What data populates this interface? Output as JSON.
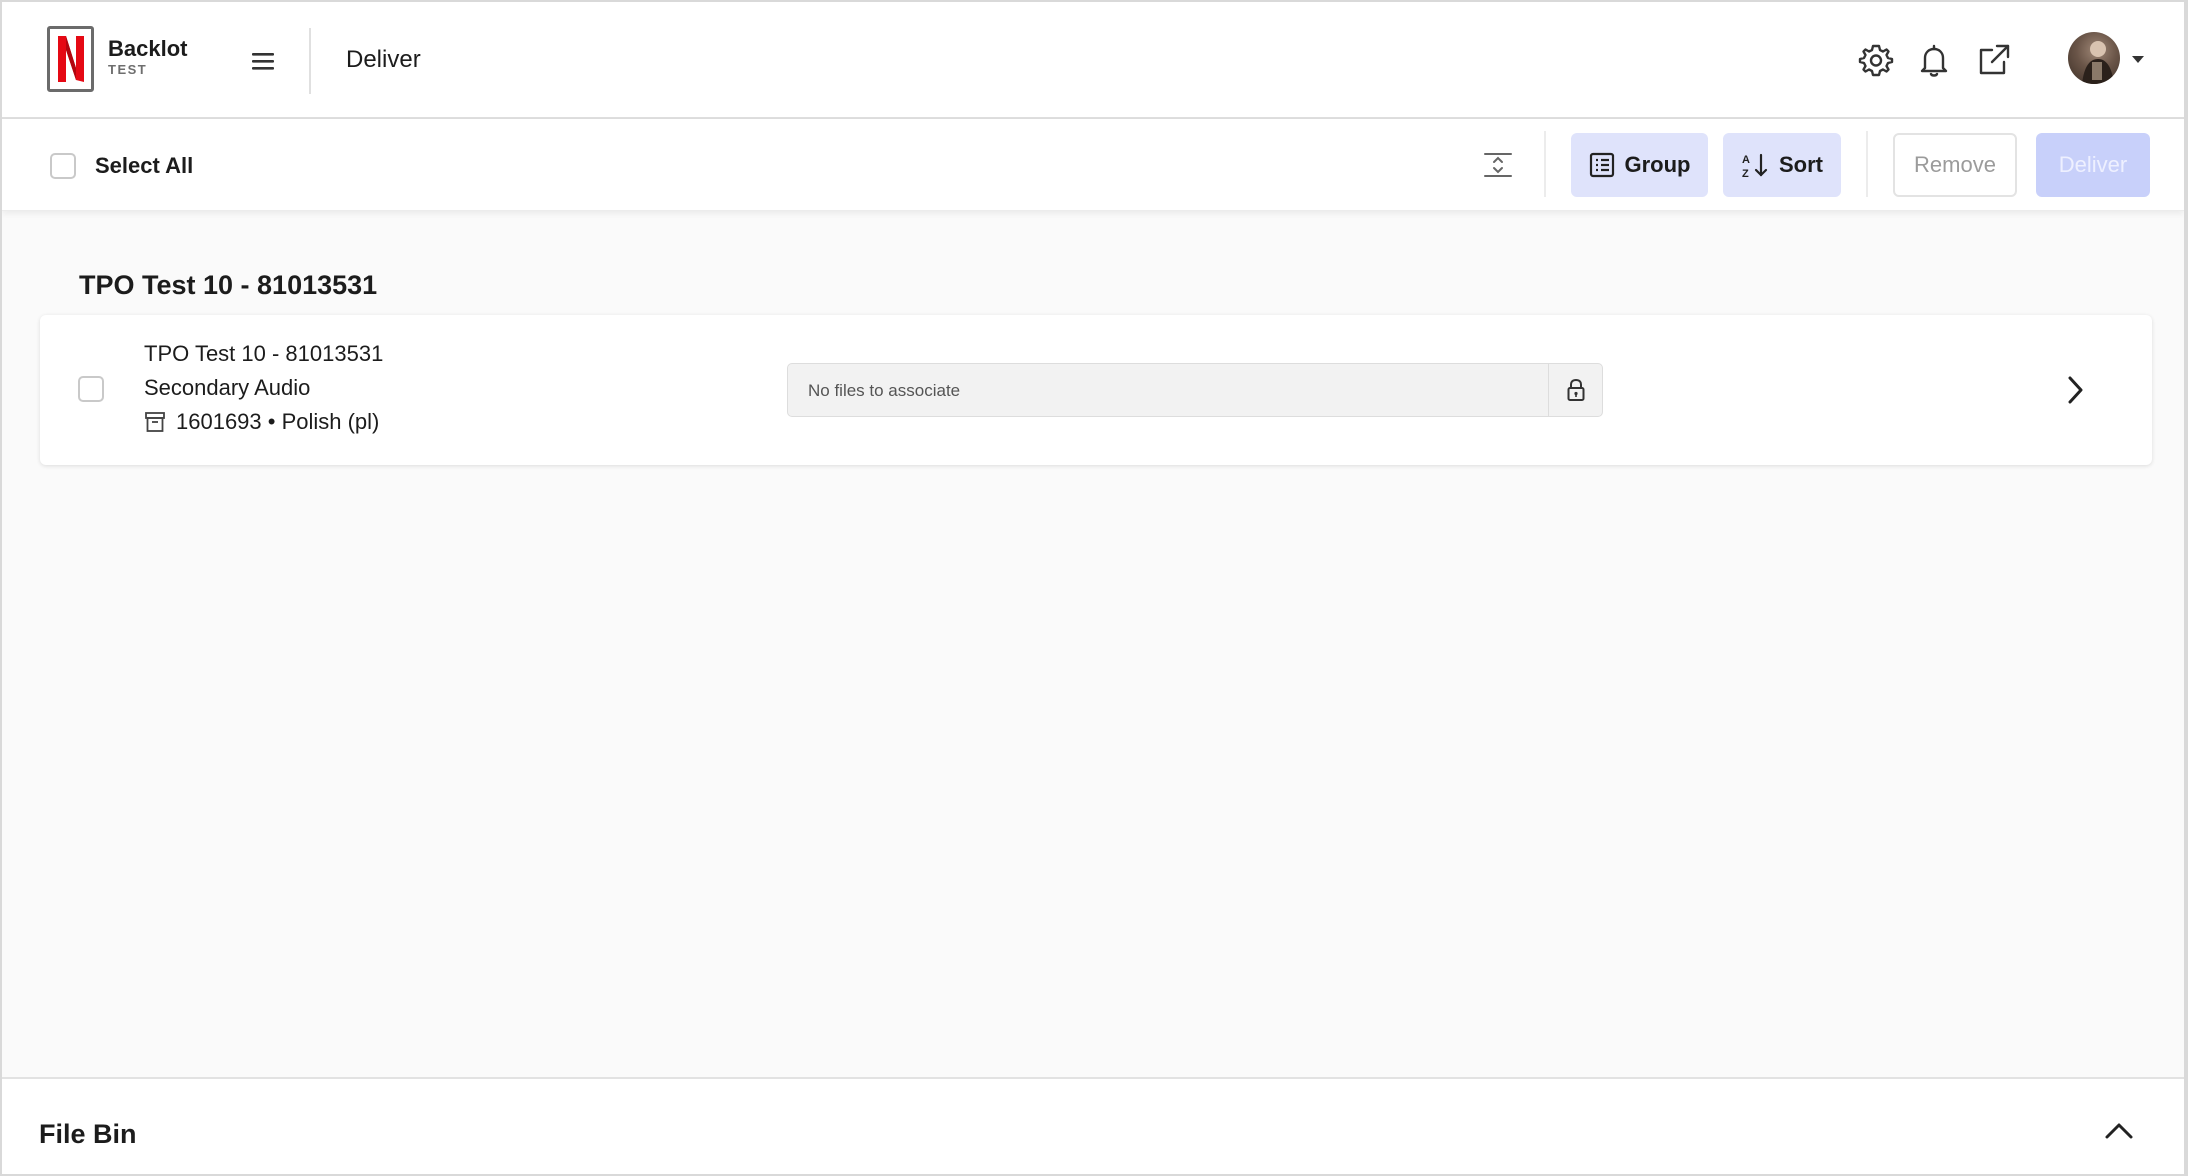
{
  "header": {
    "brand_name": "Backlot",
    "brand_env": "TEST",
    "logo_letter": "N",
    "page_title": "Deliver",
    "icons": [
      "menu-icon",
      "settings-gear-icon",
      "notification-bell-icon",
      "external-link-icon",
      "chevron-down-icon"
    ]
  },
  "toolbar": {
    "select_all_label": "Select All",
    "group_label": "Group",
    "sort_label": "Sort",
    "remove_label": "Remove",
    "deliver_label": "Deliver"
  },
  "groups": [
    {
      "title": "TPO Test 10 - 81013531",
      "items": [
        {
          "title": "TPO Test 10 - 81013531",
          "subtitle": "Secondary Audio",
          "meta": "1601693 • Polish (pl)",
          "file_field_text": "No files to associate"
        }
      ]
    }
  ],
  "file_bin": {
    "title": "File Bin"
  },
  "colors": {
    "brand_red": "#e50914",
    "soft_button": "#dfe3fb",
    "primary_disabled": "#c8d0fa",
    "background": "#fafafa"
  }
}
